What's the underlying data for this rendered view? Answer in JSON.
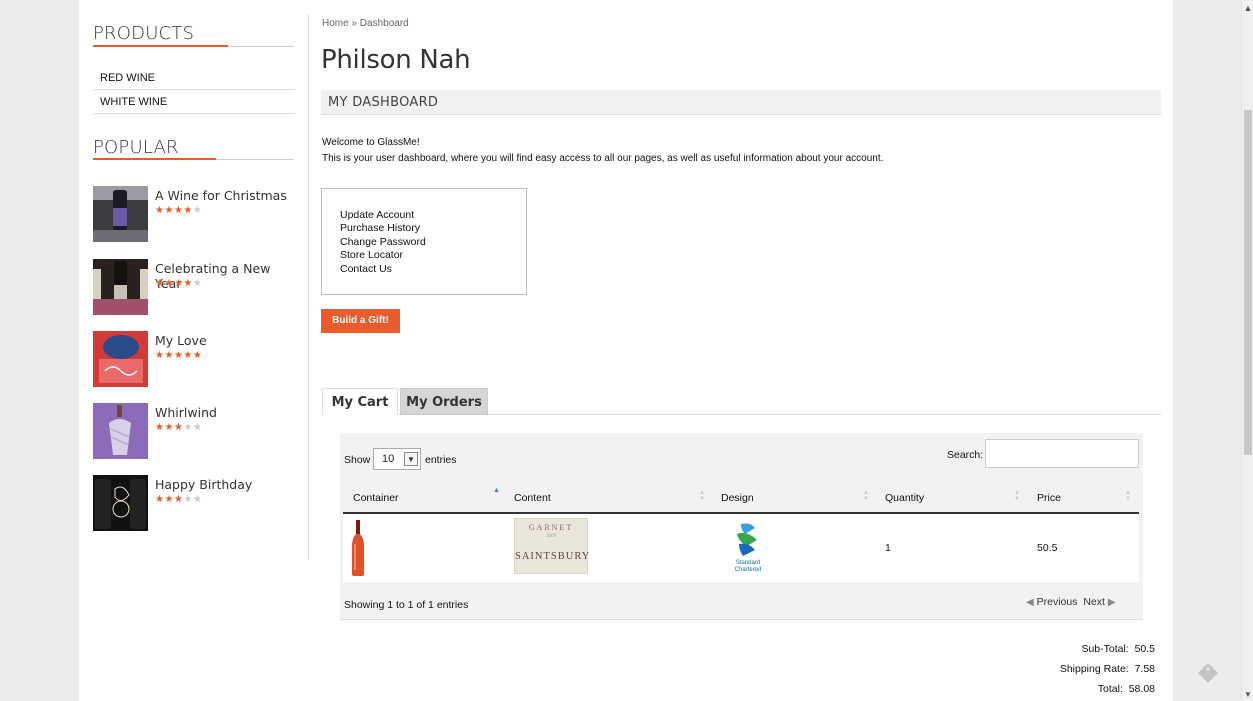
{
  "sidebar": {
    "products_heading": "PRODUCTS",
    "product_links": [
      "RED WINE",
      "WHITE WINE"
    ],
    "popular_heading": "POPULAR",
    "popular": [
      {
        "title": "A Wine for Christmas",
        "rating": 4,
        "max": 5
      },
      {
        "title": "Celebrating a New Year",
        "rating": 4,
        "max": 5
      },
      {
        "title": "My Love",
        "rating": 5,
        "max": 5
      },
      {
        "title": "Whirlwind",
        "rating": 3,
        "max": 5
      },
      {
        "title": "Happy Birthday",
        "rating": 3,
        "max": 5
      }
    ]
  },
  "breadcrumb": "Home » Dashboard",
  "user_name": "Philson Nah",
  "section_title": "MY DASHBOARD",
  "welcome": "Welcome to GlassMe!",
  "welcome_sub": "This is your user dashboard, where you will find easy access to all our pages, as well as useful information about your account.",
  "quick_links": [
    "Update Account",
    "Purchase History",
    "Change Password",
    "Store Locator",
    "Contact Us"
  ],
  "gift_button": "Build a Gift!",
  "tabs": [
    {
      "label": "My Cart",
      "active": true
    },
    {
      "label": "My Orders",
      "active": false
    }
  ],
  "table": {
    "show_label": "Show",
    "show_value": "10",
    "entries_label": "entries",
    "search_label": "Search:",
    "columns": [
      "Container",
      "Content",
      "Design",
      "Quantity",
      "Price"
    ],
    "rows": [
      {
        "container": "bottle-icon",
        "content": "wine-label-icon",
        "design": "standard-chartered-logo",
        "quantity": "1",
        "price": "50.5"
      }
    ],
    "content_label": {
      "top": "GARNET",
      "year": "2009",
      "brand": "SAINTSBURY"
    },
    "design_label": {
      "line1": "Standard",
      "line2": "Chartered"
    },
    "info": "Showing 1 to 1 of 1 entries",
    "previous": "Previous",
    "next": "Next"
  },
  "totals": {
    "subtotal_label": "Sub-Total:",
    "subtotal": "50.5",
    "shipping_label": "Shipping Rate:",
    "shipping": "7.58",
    "total_label": "Total:",
    "total": "58.08"
  },
  "colors": {
    "accent": "#e95b2d",
    "panel": "#f2f2f2",
    "tab_inactive": "#d6d6d6"
  }
}
